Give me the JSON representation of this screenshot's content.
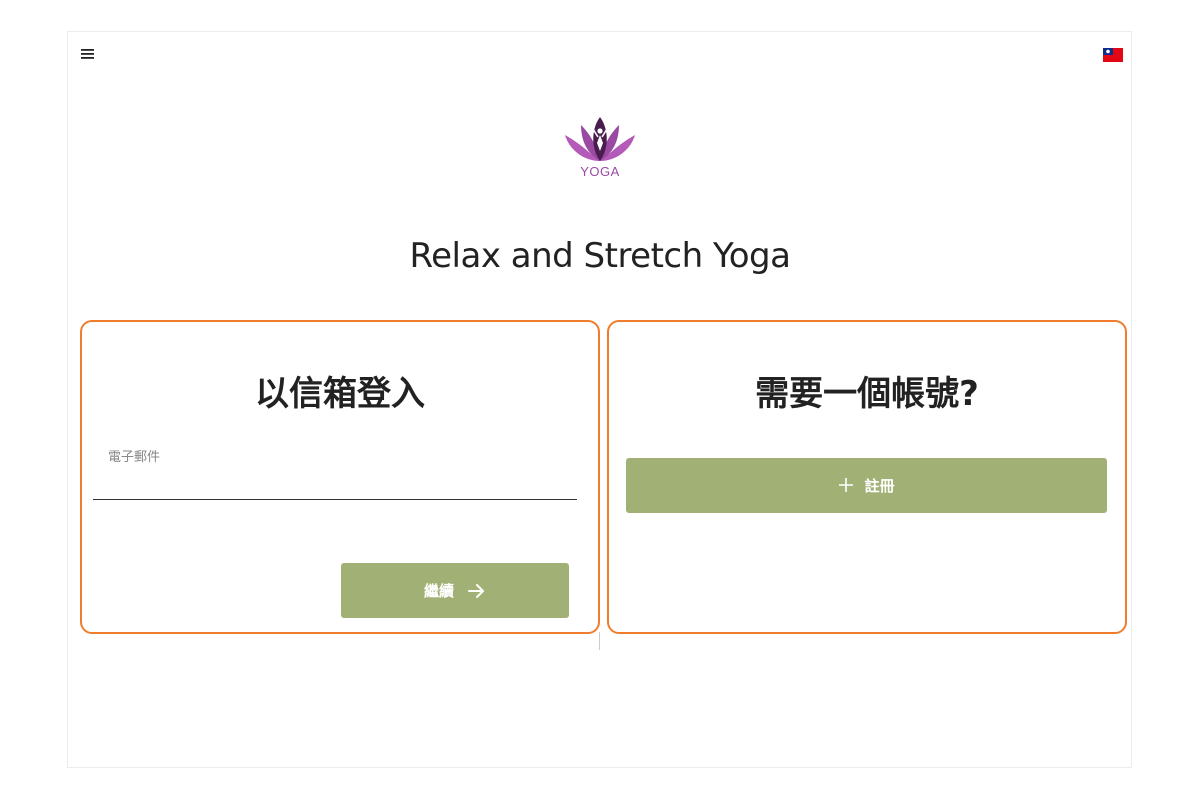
{
  "header": {
    "menu_icon": "hamburger-menu-icon",
    "language_icon": "taiwan-flag-icon"
  },
  "brand": {
    "logo_icon": "lotus-yoga-logo-icon",
    "logo_text": "YOGA",
    "site_title": "Relax and Stretch Yoga"
  },
  "login_card": {
    "title": "以信箱登入",
    "email_label": "電子郵件",
    "email_value": "",
    "continue_label": "繼續",
    "continue_icon": "arrow-right-icon"
  },
  "signup_card": {
    "title": "需要一個帳號?",
    "register_label": "註冊",
    "register_icon": "plus-icon"
  },
  "colors": {
    "accent_border": "#ef7d2d",
    "button": "#a1b175",
    "logo_purple": "#9b4aa3"
  }
}
